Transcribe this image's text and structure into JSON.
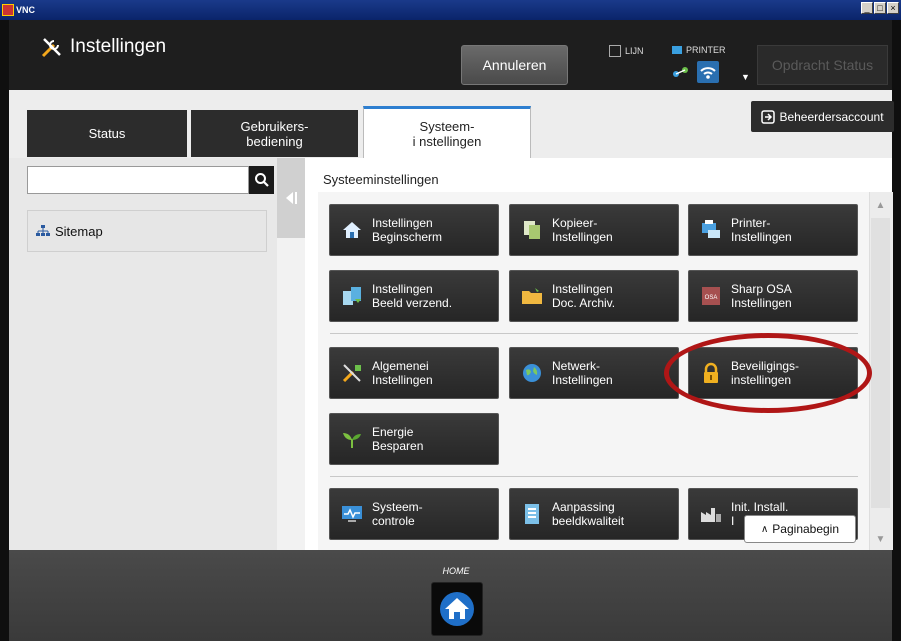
{
  "vnc": {
    "app_label": "VNC"
  },
  "header": {
    "title": "Instellingen",
    "cancel_label": "Annuleren",
    "line_label": "LIJN",
    "printer_label": "PRINTER",
    "job_status_label": "Opdracht Status"
  },
  "tabs": [
    {
      "label": "Status"
    },
    {
      "label": "Gebruikers-\nbediening"
    },
    {
      "label": "Systeem-\ni nstellingen"
    }
  ],
  "admin_button_label": "Beheerdersaccount",
  "sidebar": {
    "search_placeholder": "",
    "sitemap_label": "Sitemap"
  },
  "content": {
    "section_title": "Systeeminstellingen",
    "tiles": [
      {
        "label": "Instellingen\nBeginscherm",
        "icon": "home-icon"
      },
      {
        "label": "Kopieer-\nInstellingen",
        "icon": "copy-icon"
      },
      {
        "label": "Printer-\nInstellingen",
        "icon": "printer-icon"
      },
      {
        "label": "Instellingen\nBeeld verzend.",
        "icon": "image-send-icon"
      },
      {
        "label": "Instellingen\nDoc. Archiv.",
        "icon": "folder-icon"
      },
      {
        "label": "Sharp OSA\nInstellingen",
        "icon": "osa-icon"
      },
      {
        "label": "Algemenei\nInstellingen",
        "icon": "tools-icon"
      },
      {
        "label": "Netwerk-\nInstellingen",
        "icon": "globe-icon"
      },
      {
        "label": "Beveiligings-\ninstellingen",
        "icon": "lock-icon"
      },
      {
        "label": "Energie\nBesparen",
        "icon": "leaf-icon"
      },
      {
        "label": "Systeem-\ncontrole",
        "icon": "monitor-icon"
      },
      {
        "label": "Aanpassing\nbeeldkwaliteit",
        "icon": "image-quality-icon"
      },
      {
        "label": "Init. Install.\nI",
        "icon": "factory-icon"
      }
    ],
    "paginabegin_label": "Paginabegin"
  },
  "footer": {
    "home_label": "HOME"
  },
  "colors": {
    "accent": "#2e7fd0",
    "highlight": "#b01616",
    "tile": "#2c2c2c"
  }
}
